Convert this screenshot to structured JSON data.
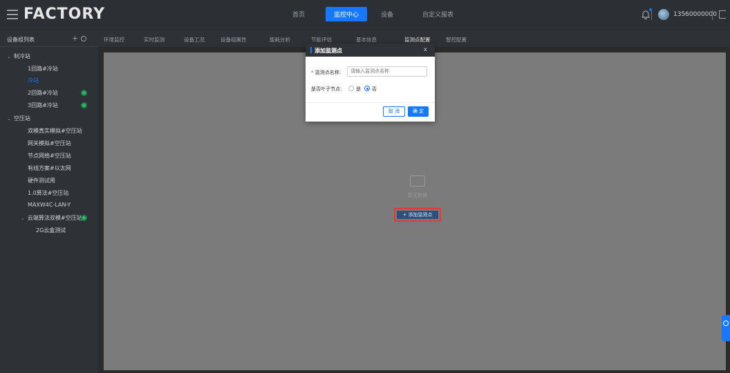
{
  "header": {
    "logo": "FACTORY",
    "nav": [
      "首页",
      "监控中心",
      "设备",
      "自定义报表"
    ],
    "active_nav_index": 1,
    "phone": "13560000000"
  },
  "sidebar": {
    "title": "设备组列表",
    "plus": "+",
    "items": [
      {
        "label": "制冷站",
        "level": 0,
        "expanded": true
      },
      {
        "label": "1回路#冷站",
        "level": 1
      },
      {
        "label": "冷站",
        "level": 1,
        "selected": true
      },
      {
        "label": "2回路#冷站",
        "level": 1,
        "has_badge": true
      },
      {
        "label": "3回路#冷站",
        "level": 1,
        "has_badge": true
      },
      {
        "label": "空压站",
        "level": 0,
        "expanded": true
      },
      {
        "label": "双模真实模拟#空压站",
        "level": 1
      },
      {
        "label": "网关模拟#空压站",
        "level": 1
      },
      {
        "label": "节点网络#空压站",
        "level": 1
      },
      {
        "label": "有线方案#以太网",
        "level": 1
      },
      {
        "label": "硬件测试用",
        "level": 1
      },
      {
        "label": "1.0算法#空压站",
        "level": 1
      },
      {
        "label": "MAXW4C-LAN-Y",
        "level": 1
      },
      {
        "label": "云端算法双模#空压站",
        "level": 1,
        "expanded": true,
        "has_badge": true
      },
      {
        "label": "2G云盒测试",
        "level": 2
      }
    ]
  },
  "tabs": [
    "环境监控",
    "实时监测",
    "设备工况",
    "设备组属性",
    "能耗分析",
    "节能评估",
    "基本信息",
    "监测点配置",
    "智控配置"
  ],
  "active_tab_index": 7,
  "main": {
    "empty_text": "暂无数据",
    "add_button": "+ 添加监测点"
  },
  "modal": {
    "title": "添加监测点",
    "close": "x",
    "name_label": "监测点名称:",
    "required_mark": "*",
    "name_placeholder": "请输入监测点名称",
    "leaf_label": "是否叶子节点:",
    "yes_label": "是",
    "no_label": "否",
    "leaf_value": "否",
    "cancel": "取 消",
    "ok": "确 定"
  },
  "colors": {
    "accent": "#1677ff",
    "highlight_border": "#e53935",
    "badge": "#3cb371"
  }
}
